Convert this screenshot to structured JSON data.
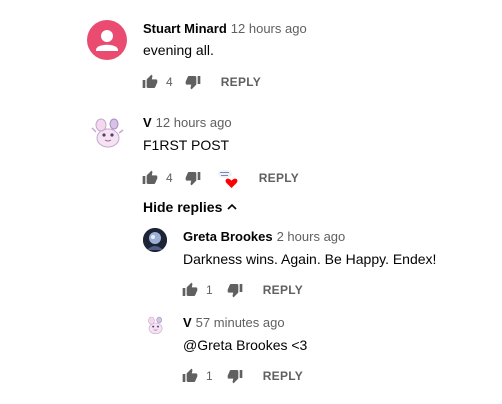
{
  "comments": [
    {
      "author": "Stuart Minard",
      "time": "12 hours ago",
      "text": "evening all.",
      "likes": "4",
      "reply_label": "REPLY",
      "avatar_color": "#e94c70"
    },
    {
      "author": "V",
      "time": "12 hours ago",
      "text": "F1RST POST",
      "likes": "4",
      "reply_label": "REPLY",
      "creator_heart": true,
      "hide_replies_label": "Hide replies",
      "replies": [
        {
          "author": "Greta Brookes",
          "time": "2 hours ago",
          "text": "Darkness wins. Again. Be Happy. Endex!",
          "likes": "1",
          "reply_label": "REPLY"
        },
        {
          "author": "V",
          "time": "57 minutes ago",
          "text": "@Greta Brookes <3",
          "likes": "1",
          "reply_label": "REPLY"
        }
      ]
    }
  ],
  "colors": {
    "heart": "#ff0000",
    "meta": "#606060",
    "text": "#030303"
  }
}
